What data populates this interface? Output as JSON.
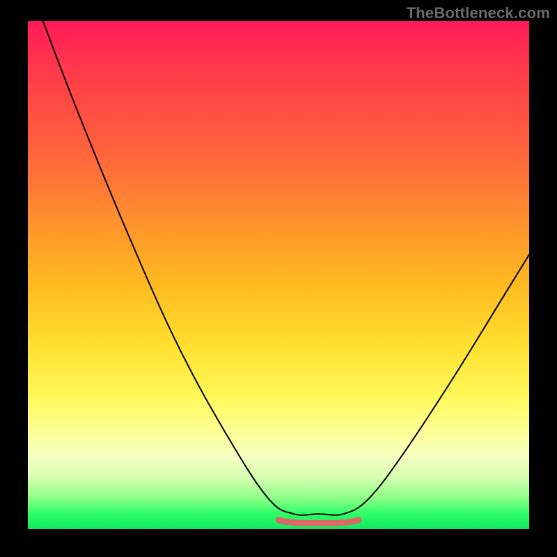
{
  "watermark": "TheBottleneck.com",
  "chart_data": {
    "type": "line",
    "title": "",
    "xlabel": "",
    "ylabel": "",
    "xlim": [
      0,
      100
    ],
    "ylim": [
      0,
      100
    ],
    "gradient_stops": [
      {
        "pos": 0,
        "color": "#ff1a57"
      },
      {
        "pos": 10,
        "color": "#ff3a4a"
      },
      {
        "pos": 28,
        "color": "#ff6a3a"
      },
      {
        "pos": 42,
        "color": "#ff9a2a"
      },
      {
        "pos": 52,
        "color": "#ffba20"
      },
      {
        "pos": 64,
        "color": "#ffe030"
      },
      {
        "pos": 74,
        "color": "#fff95a"
      },
      {
        "pos": 82,
        "color": "#fdffa0"
      },
      {
        "pos": 86,
        "color": "#f3ffc2"
      },
      {
        "pos": 90,
        "color": "#d4ffb0"
      },
      {
        "pos": 94,
        "color": "#8aff84"
      },
      {
        "pos": 97,
        "color": "#2dff6a"
      },
      {
        "pos": 100,
        "color": "#12e85e"
      }
    ],
    "series": [
      {
        "name": "main-curve",
        "color": "#000000",
        "stroke_width": 2.0,
        "points": [
          {
            "x": 3,
            "y": 100
          },
          {
            "x": 10,
            "y": 82
          },
          {
            "x": 20,
            "y": 58
          },
          {
            "x": 30,
            "y": 36
          },
          {
            "x": 40,
            "y": 18
          },
          {
            "x": 48,
            "y": 6
          },
          {
            "x": 53,
            "y": 3
          },
          {
            "x": 58,
            "y": 3
          },
          {
            "x": 63,
            "y": 3
          },
          {
            "x": 68,
            "y": 6
          },
          {
            "x": 75,
            "y": 15
          },
          {
            "x": 85,
            "y": 30
          },
          {
            "x": 95,
            "y": 46
          },
          {
            "x": 100,
            "y": 54
          }
        ]
      },
      {
        "name": "bottom-band",
        "color": "#d96a68",
        "stroke_width": 9,
        "points": [
          {
            "x": 50,
            "y": 1.8
          },
          {
            "x": 52,
            "y": 1.4
          },
          {
            "x": 55,
            "y": 1.2
          },
          {
            "x": 58,
            "y": 1.2
          },
          {
            "x": 61,
            "y": 1.2
          },
          {
            "x": 64,
            "y": 1.4
          },
          {
            "x": 66,
            "y": 1.8
          }
        ]
      }
    ]
  }
}
